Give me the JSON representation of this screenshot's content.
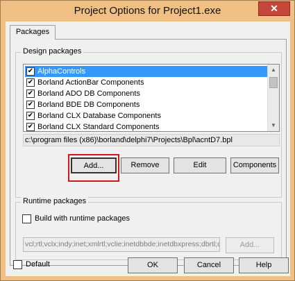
{
  "window": {
    "title": "Project Options for Project1.exe",
    "close_glyph": "✕"
  },
  "tabs": [
    {
      "label": "Packages"
    }
  ],
  "design_packages": {
    "label": "Design packages",
    "items": [
      {
        "label": "AlphaControls",
        "checked": true,
        "selected": true
      },
      {
        "label": "Borland ActionBar Components",
        "checked": true,
        "selected": false
      },
      {
        "label": "Borland ADO DB Components",
        "checked": true,
        "selected": false
      },
      {
        "label": "Borland BDE DB Components",
        "checked": true,
        "selected": false
      },
      {
        "label": "Borland CLX Database Components",
        "checked": true,
        "selected": false
      },
      {
        "label": "Borland CLX Standard Components",
        "checked": true,
        "selected": false
      }
    ],
    "path": "c:\\program files (x86)\\borland\\delphi7\\Projects\\Bpl\\acntD7.bpl",
    "buttons": {
      "add": "Add...",
      "remove": "Remove",
      "edit": "Edit",
      "components": "Components"
    }
  },
  "runtime_packages": {
    "label": "Runtime packages",
    "build_checkbox_label": "Build with runtime packages",
    "build_checked": false,
    "packages_value": "vcl;rtl;vclx;indy;inet;xmlrtl;vclie;inetdbbde;inetdbxpress;dbrtl;d",
    "add_label": "Add..."
  },
  "footer": {
    "default_label": "Default",
    "default_checked": false,
    "ok": "OK",
    "cancel": "Cancel",
    "help": "Help"
  },
  "colors": {
    "frame": "#efbf84",
    "close": "#c7463c",
    "selection": "#3399ff",
    "annotation": "#d01818"
  },
  "icons": {
    "check": "✔",
    "scroll_up": "▲",
    "scroll_down": "▼"
  }
}
